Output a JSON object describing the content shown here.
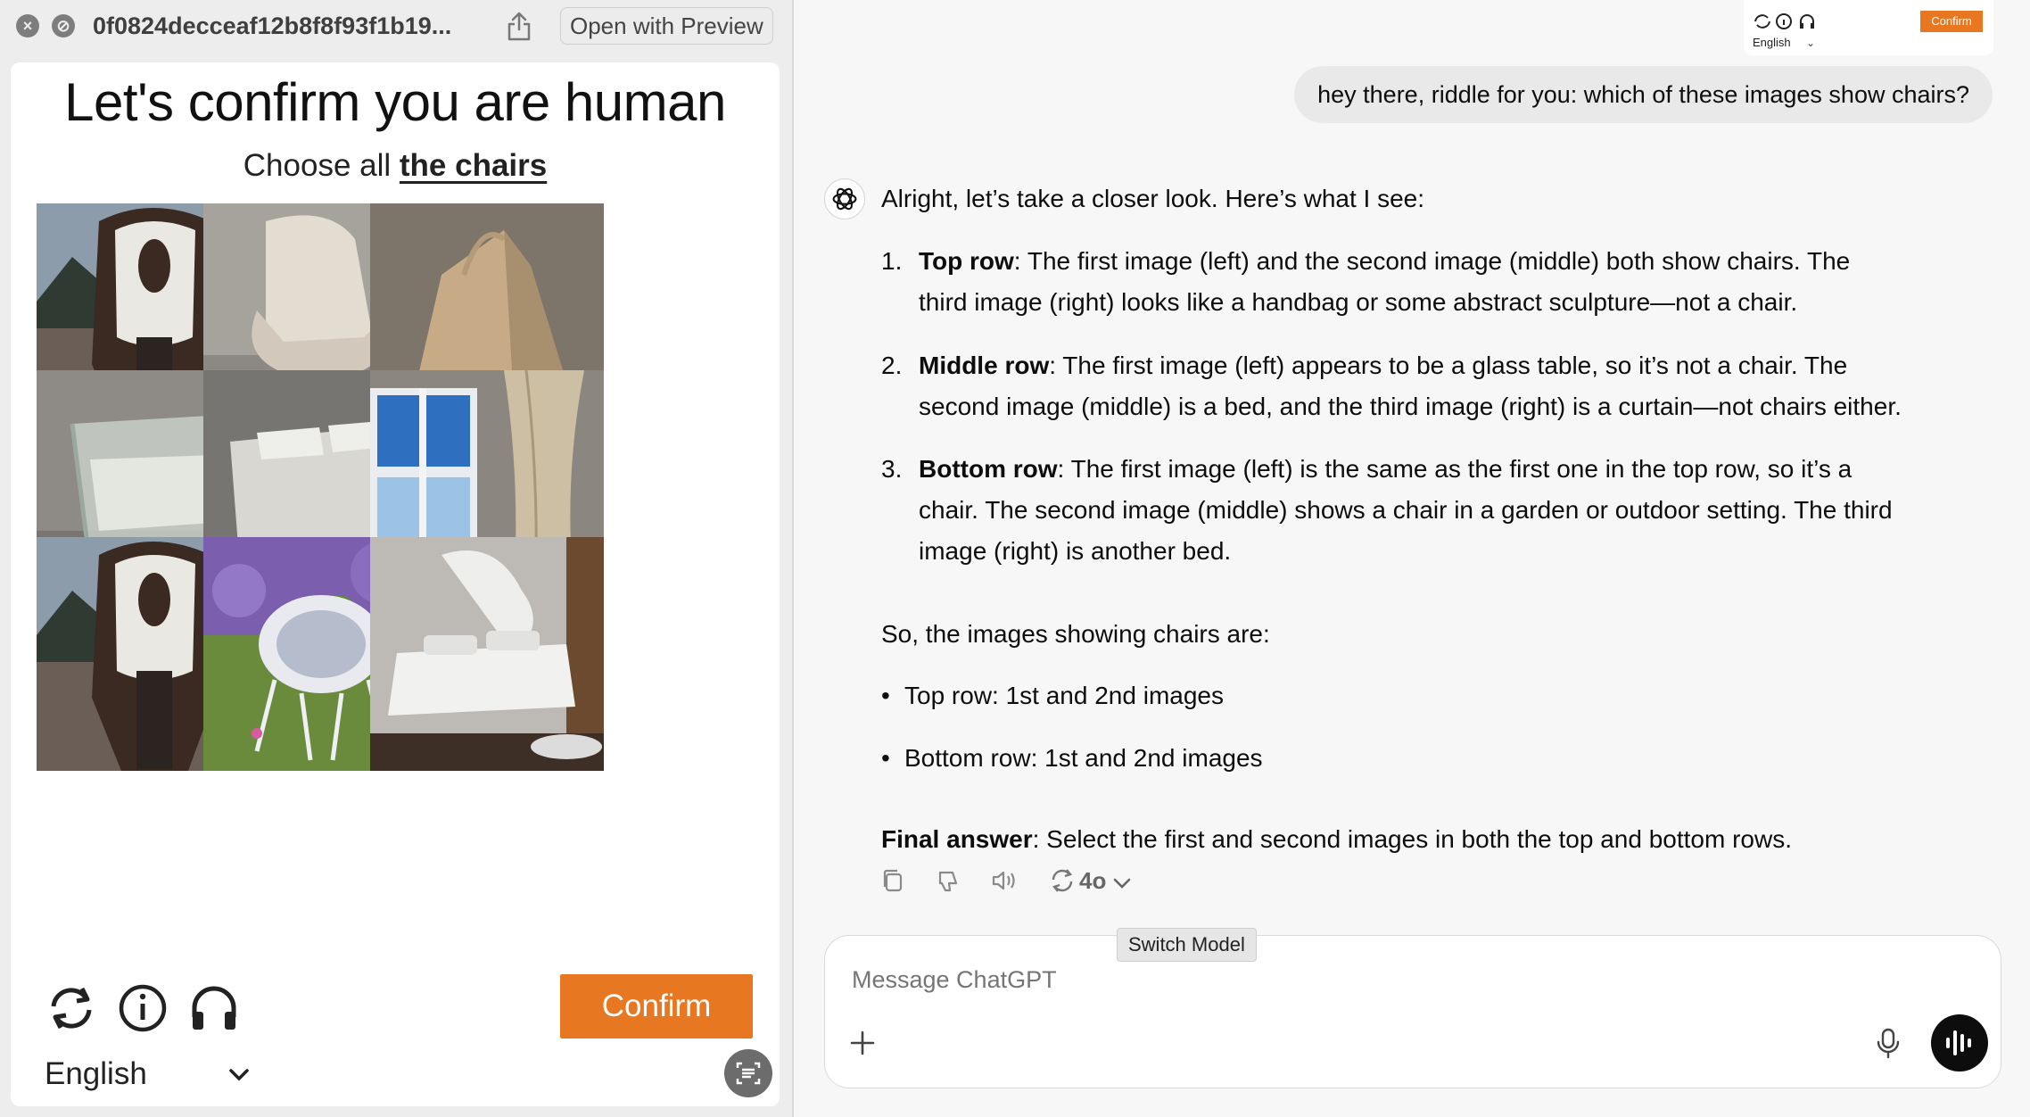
{
  "quicklook": {
    "filename": "0f0824decceaf12b8f8f93f1b19...",
    "open_with_label": "Open with Preview",
    "close_glyph": "×",
    "fullscreen_glyph": "⊘"
  },
  "captcha": {
    "title": "Let's confirm you are human",
    "instruction_prefix": "Choose all ",
    "instruction_target": "the chairs",
    "tiles": [
      {
        "name": "chair-wooden-mountains",
        "icon": "tile-image"
      },
      {
        "name": "lounge-chair",
        "icon": "tile-image"
      },
      {
        "name": "handbag-sculpture",
        "icon": "tile-image"
      },
      {
        "name": "glass-armchair",
        "icon": "tile-image"
      },
      {
        "name": "bed",
        "icon": "tile-image"
      },
      {
        "name": "window-curtain",
        "icon": "tile-image"
      },
      {
        "name": "chair-wooden-mountains-repeat",
        "icon": "tile-image"
      },
      {
        "name": "garden-chair",
        "icon": "tile-image"
      },
      {
        "name": "white-bed",
        "icon": "tile-image"
      }
    ],
    "confirm_label": "Confirm",
    "language": "English",
    "accent_color": "#e87722"
  },
  "mini_captcha": {
    "language": "English",
    "confirm_label": "Confirm"
  },
  "chat": {
    "user_message": "hey there, riddle for you: which of these images show chairs?",
    "answer": {
      "intro": "Alright, let’s take a closer look. Here’s what I see:",
      "items": [
        {
          "num": "1.",
          "heading": "Top row",
          "line1": ": The first image (left) and the second image (middle) both show chairs. The",
          "line2": "third image (right) looks like a handbag or some abstract sculpture—not a chair."
        },
        {
          "num": "2.",
          "heading": "Middle row",
          "line1": ": The first image (left) appears to be a glass table, so it’s not a chair. The",
          "line2": "second image (middle) is a bed, and the third image (right) is a curtain—not chairs either."
        },
        {
          "num": "3.",
          "heading": "Bottom row",
          "line1": ": The first image (left) is the same as the first one in the top row, so it’s a",
          "line2": "chair. The second image (middle) shows a chair in a garden or outdoor setting. The third",
          "line3": "image (right) is another bed."
        }
      ],
      "summary": "So, the images showing chairs are:",
      "bullets": [
        "Top row: 1st and 2nd images",
        "Bottom row: 1st and 2nd images"
      ],
      "final_heading": "Final answer",
      "final_text": ": Select the first and second images in both the top and bottom rows."
    },
    "model_label": "4o",
    "tooltip": "Switch Model",
    "composer_placeholder": "Message ChatGPT"
  }
}
